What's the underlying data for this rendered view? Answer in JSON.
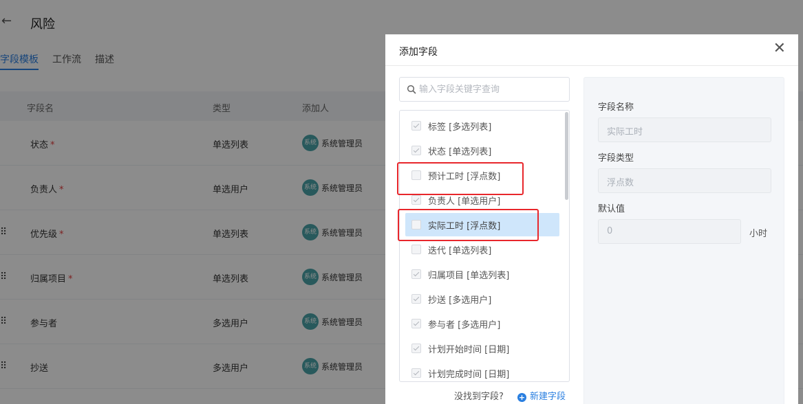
{
  "page": {
    "title": "风险",
    "back_icon": "arrow-left-icon",
    "tabs": [
      {
        "label": "字段模板",
        "active": true
      },
      {
        "label": "工作流",
        "active": false
      },
      {
        "label": "描述",
        "active": false
      }
    ],
    "table": {
      "headers": [
        "字段名",
        "类型",
        "添加人"
      ],
      "rows": [
        {
          "name": "状态",
          "required": "*",
          "type": "单选列表",
          "avatar": "系统",
          "adder": "系统管理员",
          "draggable": false
        },
        {
          "name": "负责人",
          "required": "*",
          "type": "单选用户",
          "avatar": "系统",
          "adder": "系统管理员",
          "draggable": false
        },
        {
          "name": "优先级",
          "required": "*",
          "type": "单选列表",
          "avatar": "系统",
          "adder": "系统管理员",
          "draggable": true
        },
        {
          "name": "归属项目",
          "required": "*",
          "type": "单选列表",
          "avatar": "系统",
          "adder": "系统管理员",
          "draggable": true
        },
        {
          "name": "参与者",
          "required": "",
          "type": "多选用户",
          "avatar": "系统",
          "adder": "系统管理员",
          "draggable": true
        },
        {
          "name": "抄送",
          "required": "",
          "type": "多选用户",
          "avatar": "系统",
          "adder": "系统管理员",
          "draggable": true
        }
      ]
    }
  },
  "modal": {
    "title": "添加字段",
    "close_icon": "close-icon",
    "search": {
      "placeholder": "输入字段关键字查询",
      "value": ""
    },
    "fields": [
      {
        "label": "标签 [多选列表]",
        "checked": true,
        "highlighted": false
      },
      {
        "label": "状态 [单选列表]",
        "checked": true,
        "highlighted": false
      },
      {
        "label": "预计工时 [浮点数]",
        "checked": false,
        "highlighted": false
      },
      {
        "label": "负责人 [单选用户]",
        "checked": true,
        "highlighted": false
      },
      {
        "label": "实际工时 [浮点数]",
        "checked": false,
        "highlighted": true
      },
      {
        "label": "迭代 [单选列表]",
        "checked": false,
        "highlighted": false
      },
      {
        "label": "归属项目 [单选列表]",
        "checked": true,
        "highlighted": false
      },
      {
        "label": "抄送 [多选用户]",
        "checked": true,
        "highlighted": false
      },
      {
        "label": "参与者 [多选用户]",
        "checked": true,
        "highlighted": false
      },
      {
        "label": "计划开始时间 [日期]",
        "checked": true,
        "highlighted": false
      },
      {
        "label": "计划完成时间 [日期]",
        "checked": true,
        "highlighted": false
      }
    ],
    "not_found_text": "没找到字段?",
    "new_field_label": "新建字段",
    "detail": {
      "name_label": "字段名称",
      "name_value": "实际工时",
      "type_label": "字段类型",
      "type_value": "浮点数",
      "default_label": "默认值",
      "default_value": "0",
      "unit": "小时"
    }
  },
  "colors": {
    "accent": "#2a7fe0",
    "highlight": "#cfe6fb",
    "annotation_red": "#e8262b",
    "avatar": "#4aa3a8"
  }
}
